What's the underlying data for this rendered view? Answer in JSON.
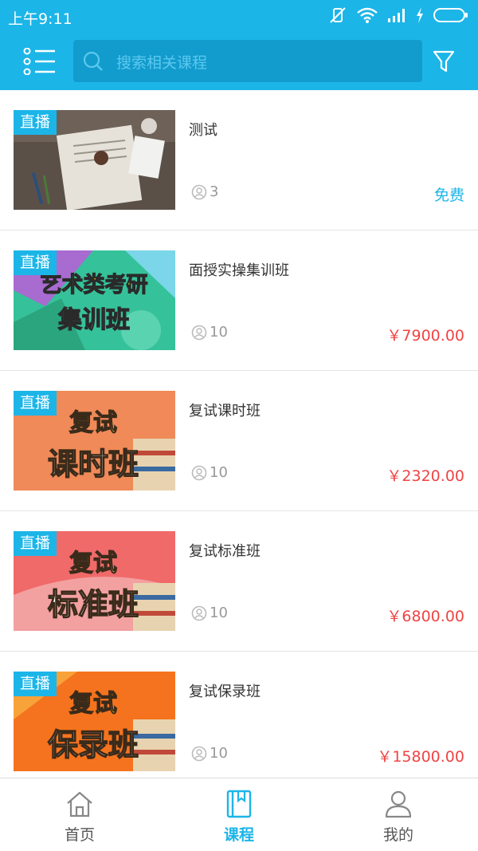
{
  "status": {
    "time": "上午9:11"
  },
  "search": {
    "placeholder": "搜索相关课程"
  },
  "tag_label": "直播",
  "courses": [
    {
      "title": "测试",
      "students": "3",
      "price": "免费",
      "thumb_words": []
    },
    {
      "title": "面授实操集训班",
      "students": "10",
      "price": "￥7900.00",
      "thumb_words": [
        "艺术类考研",
        "集训班"
      ]
    },
    {
      "title": "复试课时班",
      "students": "10",
      "price": "￥2320.00",
      "thumb_words": [
        "复试",
        "课时班"
      ]
    },
    {
      "title": "复试标准班",
      "students": "10",
      "price": "￥6800.00",
      "thumb_words": [
        "复试",
        "标准班"
      ]
    },
    {
      "title": "复试保录班",
      "students": "10",
      "price": "￥15800.00",
      "thumb_words": [
        "复试",
        "保录班"
      ]
    }
  ],
  "tabs": [
    {
      "label": "首页",
      "icon": "home-icon"
    },
    {
      "label": "课程",
      "icon": "book-icon",
      "active": true
    },
    {
      "label": "我的",
      "icon": "user-icon"
    }
  ],
  "colors": {
    "accent": "#1cb5e8",
    "price": "#f04444"
  }
}
